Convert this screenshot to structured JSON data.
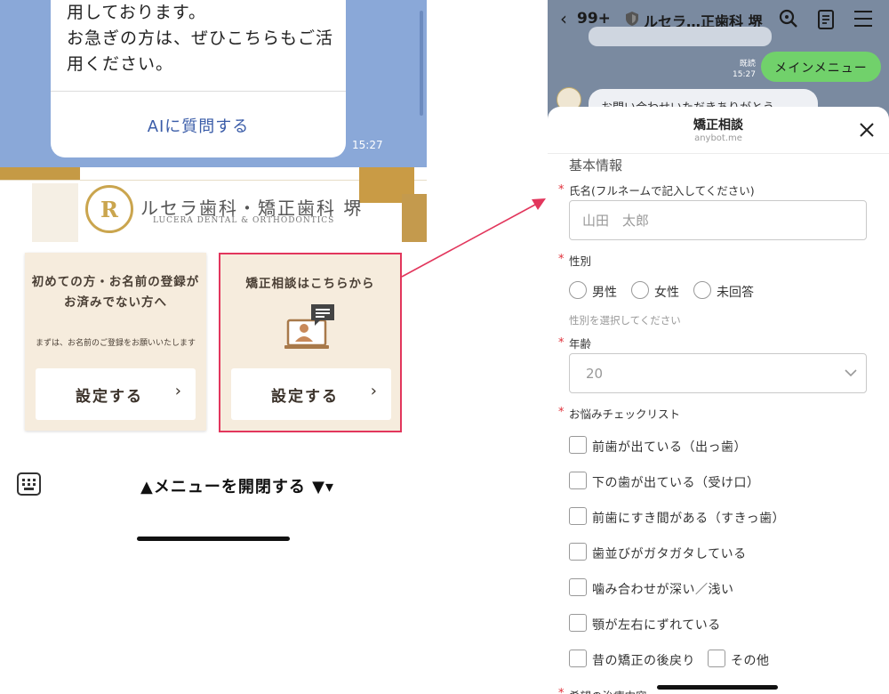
{
  "left": {
    "bubble_text": "用しております。\nお急ぎの方は、ぜひこちらもご活\n用ください。",
    "ai_link": "AIに質問する",
    "time": "15:27",
    "banner": {
      "clinic_name": "ルセラ歯科・矯正歯科 堺",
      "clinic_sub": "LUCERA DENTAL & ORTHODONTICS",
      "logo_glyph": "R"
    },
    "card1": {
      "title": "初めての方・お名前の登録が\nお済みでない方へ",
      "note": "まずは、お名前のご登録をお願いいたします",
      "button": "設定する",
      "chevron": "›"
    },
    "card2": {
      "title": "矯正相談はこちらから",
      "button": "設定する",
      "chevron": "›",
      "icon": "consultation-laptop-icon"
    },
    "menu_toggle": "▲メニューを開閉する ▼▾"
  },
  "right": {
    "header": {
      "back": "‹",
      "unread": "99+",
      "title": "ルセラ…正歯科 堺"
    },
    "chat": {
      "read_receipt": "既読\n15:27",
      "green_bubble": "メインメニュー",
      "bot_message": "お問い合わせいただきありがとう"
    },
    "sheet": {
      "title": "矯正相談",
      "domain": "anybot.me",
      "section": "基本情報",
      "name_label": "氏名(フルネームで記入してください)",
      "name_placeholder": "山田　太郎",
      "gender_label": "性別",
      "gender_options": [
        "男性",
        "女性",
        "未回答"
      ],
      "gender_hint": "性別を選択してください",
      "age_label": "年齢",
      "age_value": "20",
      "concerns_label": "お悩みチェックリスト",
      "concerns": [
        "前歯が出ている（出っ歯）",
        "下の歯が出ている（受け口）",
        "前歯にすき間がある（すきっ歯）",
        "歯並びがガタガタしている",
        "噛み合わせが深い／浅い",
        "顎が左右にずれている",
        "昔の矯正の後戻り",
        "その他"
      ],
      "cut_label": "希望の治療内容"
    }
  },
  "colors": {
    "highlight": "#e2365c",
    "line_green": "#71d16b",
    "gold": "#c99b45",
    "chat_blue": "#8aa8d8"
  }
}
